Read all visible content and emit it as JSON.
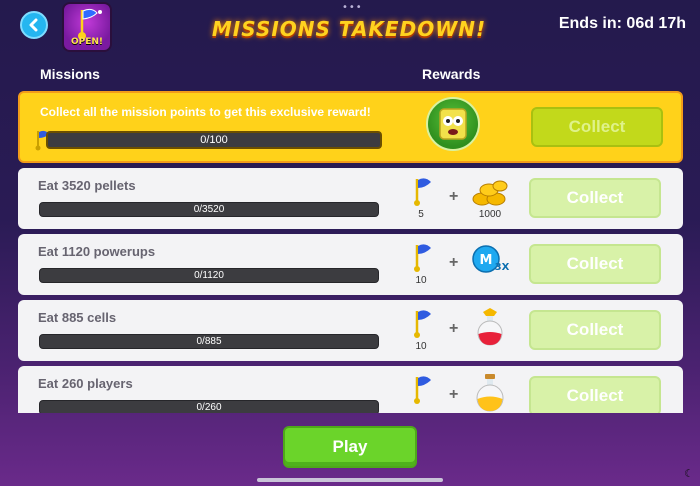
{
  "header": {
    "title": "MISSIONS TAKEDOWN!",
    "ends_in": "Ends in: 06d 17h",
    "badge_label": "OPEN!",
    "back_icon": "back-chevron-icon"
  },
  "columns": {
    "missions": "Missions",
    "rewards": "Rewards"
  },
  "special_reward": {
    "text": "Collect all the mission points to get this exclusive reward!",
    "progress_text": "0/100",
    "progress": 0,
    "collect_label": "Collect",
    "reward_icon": "sponge-skin-avatar-icon"
  },
  "missions": [
    {
      "title": "Eat 3520 pellets",
      "progress_text": "0/3520",
      "progress": 0,
      "flag_points": "5",
      "reward_icon": "coins-icon",
      "reward_amount": "1000",
      "collect_label": "Collect"
    },
    {
      "title": "Eat 1120 powerups",
      "progress_text": "0/1120",
      "progress": 0,
      "flag_points": "10",
      "reward_icon": "mass-boost-3x-icon",
      "reward_amount": "",
      "collect_label": "Collect"
    },
    {
      "title": "Eat 885 cells",
      "progress_text": "0/885",
      "progress": 0,
      "flag_points": "10",
      "reward_icon": "red-potion-icon",
      "reward_amount": "",
      "collect_label": "Collect"
    },
    {
      "title": "Eat 260 players",
      "progress_text": "0/260",
      "progress": 0,
      "flag_points": "",
      "reward_icon": "yellow-potion-icon",
      "reward_amount": "",
      "collect_label": "Collect"
    }
  ],
  "play_label": "Play",
  "colors": {
    "accent_green": "#6bd42a",
    "special_yellow": "#ffd21a",
    "back_blue": "#25b6f0"
  }
}
